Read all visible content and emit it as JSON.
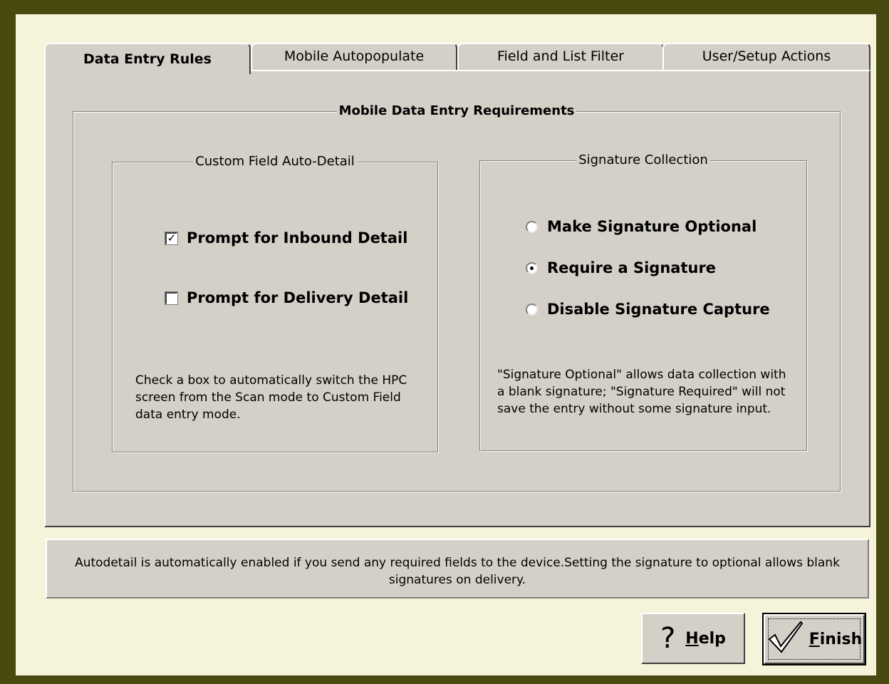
{
  "tabs": [
    {
      "label": "Data Entry Rules",
      "active": true
    },
    {
      "label": "Mobile Autopopulate",
      "active": false
    },
    {
      "label": "Field and List Filter",
      "active": false
    },
    {
      "label": "User/Setup Actions",
      "active": false
    }
  ],
  "main_group": {
    "title": "Mobile Data Entry Requirements"
  },
  "custom_field_group": {
    "title": "Custom Field Auto-Detail",
    "inbound": {
      "label": "Prompt for Inbound Detail",
      "checked": true
    },
    "delivery": {
      "label": "Prompt for Delivery Detail",
      "checked": false
    },
    "note_lines": [
      "Check a box to automatically switch the HPC",
      "screen from the Scan mode to Custom Field",
      "data entry mode."
    ]
  },
  "signature_group": {
    "title": "Signature Collection",
    "options": [
      {
        "label": "Make Signature Optional",
        "selected": false
      },
      {
        "label": "Require a Signature",
        "selected": true
      },
      {
        "label": "Disable Signature Capture",
        "selected": false
      }
    ],
    "note_lines": [
      "\"Signature Optional\" allows data collection with",
      "a blank signature; \"Signature Required\" will not",
      "save the entry without some signature input."
    ]
  },
  "status_text": "Autodetail is automatically enabled if you send any required fields to the device.Setting the signature to optional allows blank signatures on delivery.",
  "buttons": {
    "help": {
      "label_mnemonic": "H",
      "label_rest": "elp",
      "icon": "question-mark-icon"
    },
    "finish": {
      "label_mnemonic": "F",
      "label_rest": "inish",
      "icon": "checkmark-icon"
    }
  },
  "colors": {
    "frame": "#4a4a10",
    "background": "#f5f3d9",
    "face": "#d4d0c8"
  }
}
